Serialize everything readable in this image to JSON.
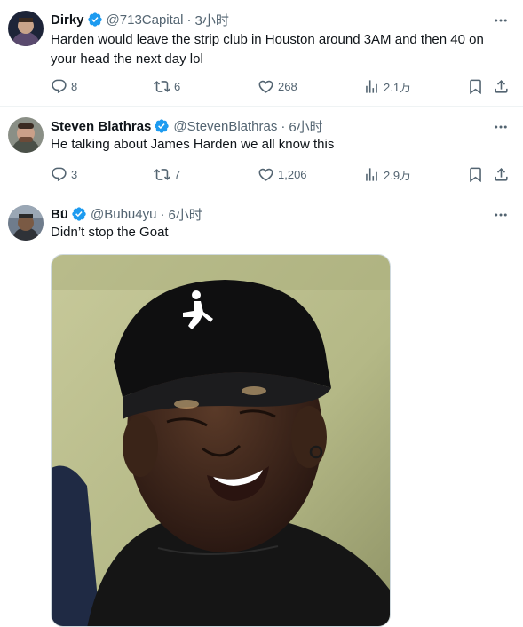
{
  "tweets": [
    {
      "name": "Dirky",
      "handle": "@713Capital",
      "sep": "·",
      "time": "3小时",
      "text": "Harden would leave the strip club in Houston around 3AM and then 40 on your head the next day lol",
      "stats": {
        "replies": "8",
        "retweets": "6",
        "likes": "268",
        "views": "2.1万"
      }
    },
    {
      "name": "Steven Blathras",
      "handle": "@StevenBlathras",
      "sep": "·",
      "time": "6小时",
      "text": "He talking about  James Harden we all know this",
      "stats": {
        "replies": "3",
        "retweets": "7",
        "likes": "1,206",
        "views": "2.9万"
      }
    },
    {
      "name": "Bü",
      "handle": "@Bubu4yu",
      "sep": "·",
      "time": "6小时",
      "text": "Didn’t stop the Goat"
    }
  ],
  "colors": {
    "verified": "#1d9bf0",
    "secondary": "#536471",
    "primary": "#0f1419",
    "divider": "#eff3f4"
  },
  "icons": [
    "reply-icon",
    "retweet-icon",
    "like-icon",
    "views-icon",
    "bookmark-icon",
    "share-icon",
    "more-icon",
    "verified-badge-icon"
  ]
}
